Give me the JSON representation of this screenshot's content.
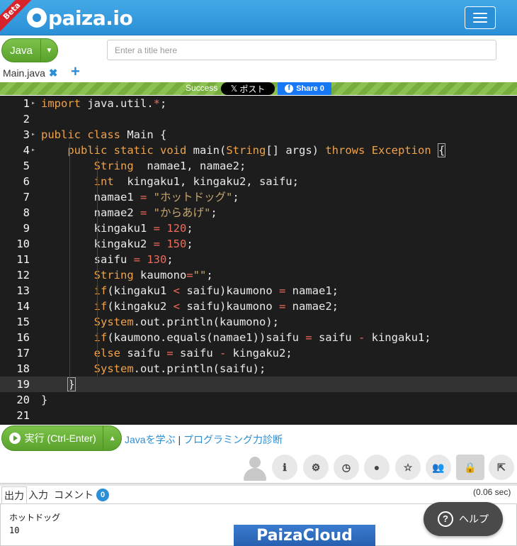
{
  "header": {
    "beta": "Beta",
    "logo": "paiza.io",
    "menu_icon": "hamburger-icon"
  },
  "language": {
    "label": "Java"
  },
  "title_input": {
    "placeholder": "Enter a title here",
    "value": ""
  },
  "file_tab": {
    "name": "Main.java"
  },
  "status": {
    "text": "Success",
    "xpost": "ポスト",
    "fb_share": "Share 0"
  },
  "editor": {
    "lines": [
      {
        "n": "1",
        "html": "<span class=\"kw\">import</span> java.util.<span class=\"op\">*</span>;"
      },
      {
        "n": "2",
        "html": ""
      },
      {
        "n": "3",
        "html": "<span class=\"kw\">public</span> <span class=\"kw\">class</span> Main {"
      },
      {
        "n": "4",
        "html": "    <span class=\"kw\">public</span> <span class=\"kw\">static</span> <span class=\"kw\">void</span> main(<span class=\"ty\">String</span>[] args) <span class=\"kw\">throws</span> <span class=\"ty\">Exception</span> <span class=\"cursor-brace\">{</span>"
      },
      {
        "n": "5",
        "html": "        <span class=\"ty\">String</span>  namae1, namae2;"
      },
      {
        "n": "6",
        "html": "        <span class=\"ty\">int</span>  kingaku1, kingaku2, saifu;"
      },
      {
        "n": "7",
        "html": "        namae1 <span class=\"op\">=</span> <span class=\"str\">\"ホットドッグ\"</span>;"
      },
      {
        "n": "8",
        "html": "        namae2 <span class=\"op\">=</span> <span class=\"str\">\"からあげ\"</span>;"
      },
      {
        "n": "9",
        "html": "        kingaku1 <span class=\"op\">=</span> <span class=\"num\">120</span>;"
      },
      {
        "n": "10",
        "html": "        kingaku2 <span class=\"op\">=</span> <span class=\"num\">150</span>;"
      },
      {
        "n": "11",
        "html": "        saifu <span class=\"op\">=</span> <span class=\"num\">130</span>;"
      },
      {
        "n": "12",
        "html": "        <span class=\"ty\">String</span> kaumono<span class=\"op\">=</span><span class=\"str\">\"\"</span>;"
      },
      {
        "n": "13",
        "html": "        <span class=\"kw\">if</span>(kingaku1 <span class=\"op\">&lt;</span> saifu)kaumono <span class=\"op\">=</span> namae1;"
      },
      {
        "n": "14",
        "html": "        <span class=\"kw\">if</span>(kingaku2 <span class=\"op\">&lt;</span> saifu)kaumono <span class=\"op\">=</span> namae2;"
      },
      {
        "n": "15",
        "html": "        <span class=\"ty\">System</span>.out.println(kaumono);"
      },
      {
        "n": "16",
        "html": "        <span class=\"kw\">if</span>(kaumono.equals(namae1))saifu <span class=\"op\">=</span> saifu <span class=\"op\">-</span> kingaku1;"
      },
      {
        "n": "17",
        "html": "        <span class=\"kw\">else</span> saifu <span class=\"op\">=</span> saifu <span class=\"op\">-</span> kingaku2;"
      },
      {
        "n": "18",
        "html": "        <span class=\"ty\">System</span>.out.println(saifu);"
      },
      {
        "n": "19",
        "html": "    <span class=\"cursor-brace\">}</span>"
      },
      {
        "n": "20",
        "html": "}"
      },
      {
        "n": "21",
        "html": ""
      }
    ],
    "active_line": 19,
    "fold_lines": [
      1,
      3,
      4
    ]
  },
  "run": {
    "label": "実行 (Ctrl-Enter)",
    "learn_link": "Javaを学ぶ",
    "separator": "|",
    "diag_link": "プログラミング力診断"
  },
  "toolbar": {
    "icons": [
      "info-icon",
      "gear-icon",
      "clock-icon",
      "github-icon",
      "star-icon",
      "group-icon",
      "lock-icon",
      "share-icon"
    ]
  },
  "output": {
    "tabs": [
      "出力",
      "入力",
      "コメント"
    ],
    "comment_count": "0",
    "exec_time": "(0.06 sec)",
    "lines": [
      "ホットドッグ",
      "10"
    ]
  },
  "ad": {
    "label": "PaizaCloud"
  },
  "help": {
    "label": "ヘルプ",
    "icon": "?"
  }
}
